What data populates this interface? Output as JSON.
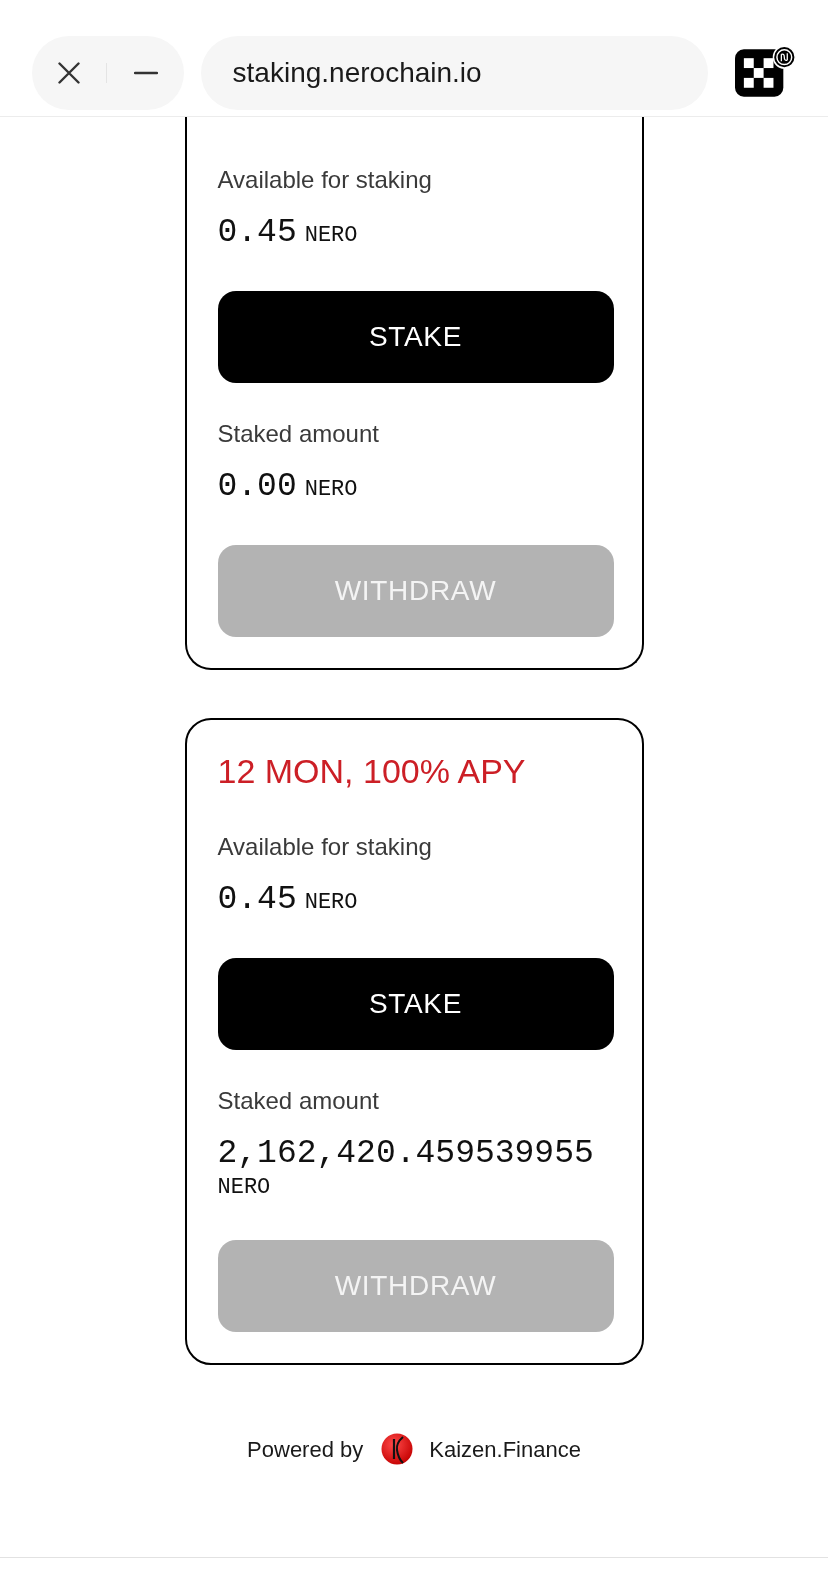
{
  "browser_bar": {
    "url": "staking.nerochain.io"
  },
  "staking_cards": [
    {
      "available_label": "Available for staking",
      "available_amount": "0.45",
      "available_unit": "NERO",
      "stake_button": {
        "label": "STAKE",
        "disabled": false
      },
      "staked_label": "Staked amount",
      "staked_amount": "0.00",
      "staked_unit": "NERO",
      "withdraw_button": {
        "label": "WITHDRAW",
        "disabled": true
      }
    },
    {
      "title": "12 MON, 100% APY",
      "available_label": "Available for staking",
      "available_amount": "0.45",
      "available_unit": "NERO",
      "stake_button": {
        "label": "STAKE",
        "disabled": false
      },
      "staked_label": "Staked amount",
      "staked_amount": "2,162,420.459539955",
      "staked_unit": "NERO",
      "withdraw_button": {
        "label": "WITHDRAW",
        "disabled": true
      }
    }
  ],
  "footer": {
    "powered_by": "Powered by",
    "brand": "Kaizen.Finance"
  }
}
